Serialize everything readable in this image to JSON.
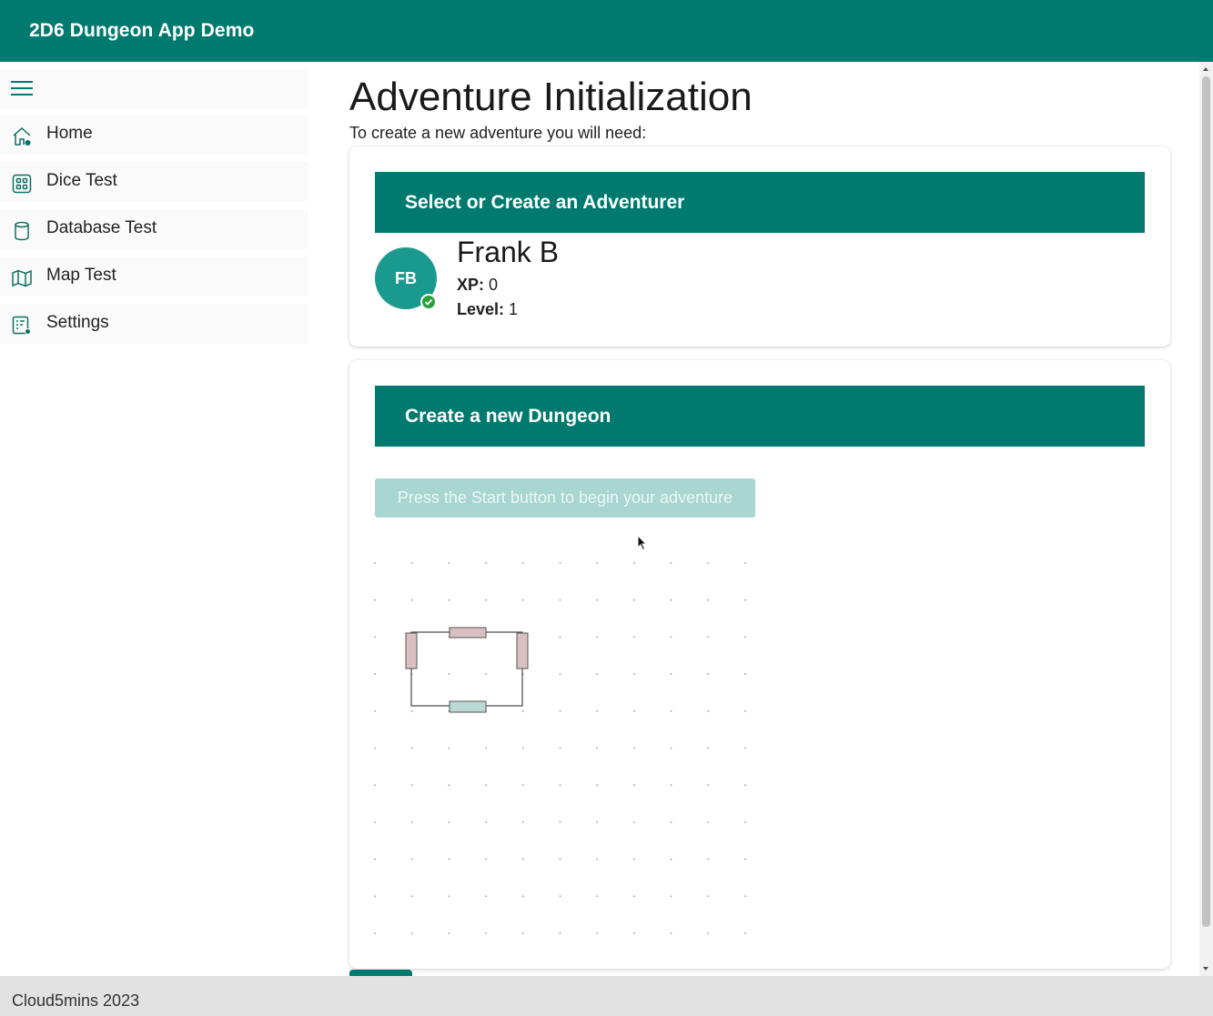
{
  "app": {
    "title": "2D6 Dungeon App Demo"
  },
  "sidebar": {
    "toggle_icon": "hamburger-menu-icon",
    "items": [
      {
        "label": "Home",
        "icon": "home-icon"
      },
      {
        "label": "Dice Test",
        "icon": "dice-grid-icon"
      },
      {
        "label": "Database Test",
        "icon": "database-icon"
      },
      {
        "label": "Map Test",
        "icon": "map-icon"
      },
      {
        "label": "Settings",
        "icon": "settings-list-icon"
      }
    ]
  },
  "main": {
    "title": "Adventure Initialization",
    "subtitle": "To create a new adventure you will need:",
    "adventurer_card": {
      "header": "Select or Create an Adventurer",
      "adventurer": {
        "initials": "FB",
        "name": "Frank B",
        "xp_label": "XP:",
        "xp": "0",
        "level_label": "Level:",
        "level": "1"
      }
    },
    "dungeon_card": {
      "header": "Create a new Dungeon",
      "start_button": "Press the Start button to begin your adventure"
    }
  },
  "footer": {
    "text": "Cloud5mins 2023"
  },
  "colors": {
    "primary": "#007a6e",
    "avatar": "#1a9a8e",
    "status_ok": "#2e9e3a",
    "button_disabled": "#a9d6d0",
    "door_side": "#d9bfc2",
    "door_bottom": "#b9d8d6"
  }
}
